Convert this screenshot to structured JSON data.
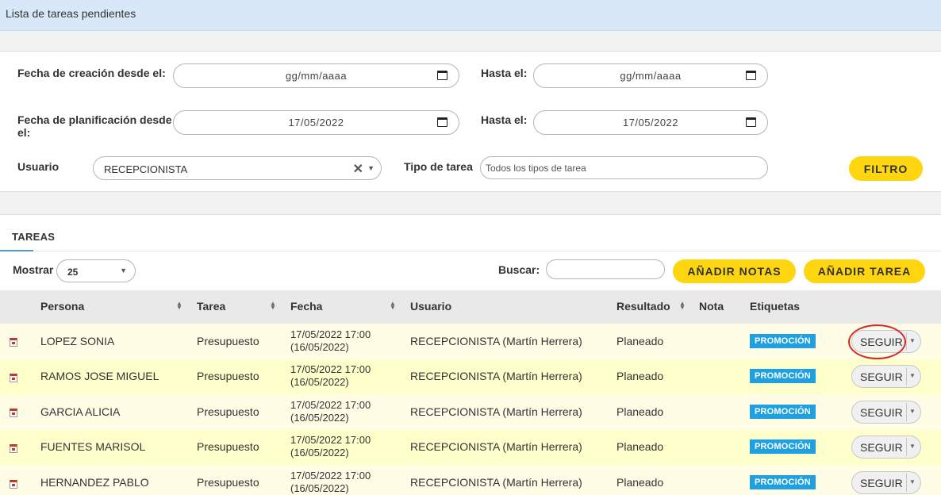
{
  "page": {
    "title": "Lista de tareas pendientes"
  },
  "filters": {
    "creation_from_label": "Fecha de creación desde el:",
    "creation_from_value": "gg/mm/aaaa",
    "creation_to_label": "Hasta el:",
    "creation_to_value": "gg/mm/aaaa",
    "planning_from_label_1": "Fecha de planificación desde",
    "planning_from_label_2": "el:",
    "planning_from_value": "17/05/2022",
    "planning_to_label": "Hasta el:",
    "planning_to_value": "17/05/2022",
    "user_label": "Usuario",
    "user_value": "RECEPCIONISTA",
    "task_type_label": "Tipo de tarea",
    "task_type_placeholder": "Todos los tipos de tarea",
    "filter_button": "FILTRO"
  },
  "tasks": {
    "tab_label": "TAREAS",
    "show_label": "Mostrar",
    "show_value": "25",
    "search_label": "Buscar:",
    "add_notes_button": "AÑADIR NOTAS",
    "add_task_button": "AÑADIR TAREA",
    "columns": {
      "persona": "Persona",
      "tarea": "Tarea",
      "fecha": "Fecha",
      "usuario": "Usuario",
      "resultado": "Resultado",
      "nota": "Nota",
      "etiquetas": "Etiquetas"
    },
    "rows": [
      {
        "persona": "LOPEZ SONIA",
        "tarea": "Presupuesto",
        "fecha_1": "17/05/2022 17:00",
        "fecha_2": "(16/05/2022)",
        "usuario": "RECEPCIONISTA (Martín Herrera)",
        "resultado": "Planeado",
        "etiqueta": "PROMOCIÓN",
        "accion": "SEGUIR"
      },
      {
        "persona": "RAMOS JOSE MIGUEL",
        "tarea": "Presupuesto",
        "fecha_1": "17/05/2022 17:00",
        "fecha_2": "(16/05/2022)",
        "usuario": "RECEPCIONISTA (Martín Herrera)",
        "resultado": "Planeado",
        "etiqueta": "PROMOCIÓN",
        "accion": "SEGUIR"
      },
      {
        "persona": "GARCIA ALICIA",
        "tarea": "Presupuesto",
        "fecha_1": "17/05/2022 17:00",
        "fecha_2": "(16/05/2022)",
        "usuario": "RECEPCIONISTA (Martín Herrera)",
        "resultado": "Planeado",
        "etiqueta": "PROMOCIÓN",
        "accion": "SEGUIR"
      },
      {
        "persona": "FUENTES MARISOL",
        "tarea": "Presupuesto",
        "fecha_1": "17/05/2022 17:00",
        "fecha_2": "(16/05/2022)",
        "usuario": "RECEPCIONISTA (Martín Herrera)",
        "resultado": "Planeado",
        "etiqueta": "PROMOCIÓN",
        "accion": "SEGUIR"
      },
      {
        "persona": "HERNANDEZ PABLO",
        "tarea": "Presupuesto",
        "fecha_1": "17/05/2022 17:00",
        "fecha_2": "(16/05/2022)",
        "usuario": "RECEPCIONISTA (Martín Herrera)",
        "resultado": "Planeado",
        "etiqueta": "PROMOCIÓN",
        "accion": "SEGUIR"
      }
    ]
  },
  "colors": {
    "header_bg": "#d9e8f8",
    "accent_yellow": "#ffd510",
    "badge_blue": "#1fa0e0",
    "row_odd": "#fffde6",
    "row_even": "#ffffcc",
    "highlight": "#d62828"
  }
}
